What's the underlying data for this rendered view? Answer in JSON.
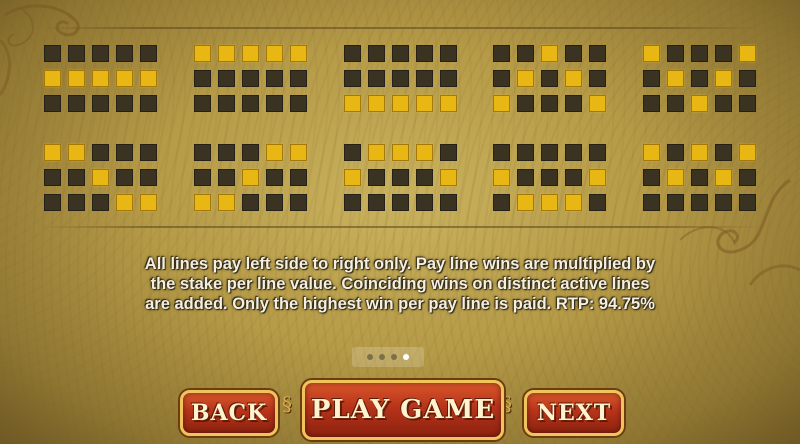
{
  "paylines_top": [
    [
      [
        0,
        0,
        0,
        0,
        0
      ],
      [
        1,
        1,
        1,
        1,
        1
      ],
      [
        0,
        0,
        0,
        0,
        0
      ]
    ],
    [
      [
        1,
        1,
        1,
        1,
        1
      ],
      [
        0,
        0,
        0,
        0,
        0
      ],
      [
        0,
        0,
        0,
        0,
        0
      ]
    ],
    [
      [
        0,
        0,
        0,
        0,
        0
      ],
      [
        0,
        0,
        0,
        0,
        0
      ],
      [
        1,
        1,
        1,
        1,
        1
      ]
    ],
    [
      [
        0,
        0,
        1,
        0,
        0
      ],
      [
        0,
        1,
        0,
        1,
        0
      ],
      [
        1,
        0,
        0,
        0,
        1
      ]
    ],
    [
      [
        1,
        0,
        0,
        0,
        1
      ],
      [
        0,
        1,
        0,
        1,
        0
      ],
      [
        0,
        0,
        1,
        0,
        0
      ]
    ]
  ],
  "paylines_bottom": [
    [
      [
        1,
        1,
        0,
        0,
        0
      ],
      [
        0,
        0,
        1,
        0,
        0
      ],
      [
        0,
        0,
        0,
        1,
        1
      ]
    ],
    [
      [
        0,
        0,
        0,
        1,
        1
      ],
      [
        0,
        0,
        1,
        0,
        0
      ],
      [
        1,
        1,
        0,
        0,
        0
      ]
    ],
    [
      [
        0,
        1,
        1,
        1,
        0
      ],
      [
        1,
        0,
        0,
        0,
        1
      ],
      [
        0,
        0,
        0,
        0,
        0
      ]
    ],
    [
      [
        0,
        0,
        0,
        0,
        0
      ],
      [
        1,
        0,
        0,
        0,
        1
      ],
      [
        0,
        1,
        1,
        1,
        0
      ]
    ],
    [
      [
        1,
        0,
        1,
        0,
        1
      ],
      [
        0,
        1,
        0,
        1,
        0
      ],
      [
        0,
        0,
        0,
        0,
        0
      ]
    ]
  ],
  "rules": {
    "line1": "All lines pay left side to right only. Pay line wins are multiplied by",
    "line2": "the stake per line value. Coinciding wins on distinct active lines",
    "line3": "are added. Only the highest win per pay line is paid. RTP: 94.75%"
  },
  "pager": {
    "total": 4,
    "active_index": 3
  },
  "buttons": {
    "back": "BACK",
    "play": "PLAY GAME",
    "next": "NEXT"
  },
  "colors": {
    "cell_on": "#e8b714",
    "cell_off": "#3a3322",
    "button_red": "#b7331a",
    "button_border": "#f0c35d"
  }
}
